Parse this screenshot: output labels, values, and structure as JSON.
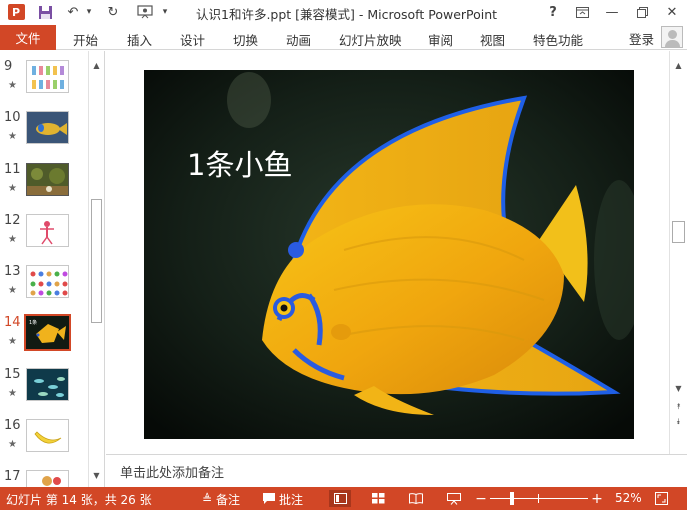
{
  "window": {
    "title": "认识1和许多.ppt [兼容模式] - Microsoft PowerPoint",
    "app_icon_letter": "P"
  },
  "ribbon": {
    "file_tab": "文件",
    "tabs": [
      "开始",
      "插入",
      "设计",
      "切换",
      "动画",
      "幻灯片放映",
      "审阅",
      "视图",
      "特色功能"
    ],
    "login": "登录"
  },
  "thumbnails": [
    {
      "number": "9",
      "star": "★"
    },
    {
      "number": "10",
      "star": "★"
    },
    {
      "number": "11",
      "star": "★"
    },
    {
      "number": "12",
      "star": "★"
    },
    {
      "number": "13",
      "star": "★"
    },
    {
      "number": "14",
      "star": "★",
      "selected": true
    },
    {
      "number": "15",
      "star": "★"
    },
    {
      "number": "16",
      "star": "★"
    },
    {
      "number": "17",
      "star": "★"
    }
  ],
  "slide": {
    "title": "1条小鱼"
  },
  "notes": {
    "placeholder": "单击此处添加备注"
  },
  "statusbar": {
    "slide_info": "幻灯片 第 14 张，共 26 张",
    "notes_label": "备注",
    "comments_label": "批注",
    "zoom_percent": "52%"
  },
  "colors": {
    "accent": "#d24726"
  }
}
